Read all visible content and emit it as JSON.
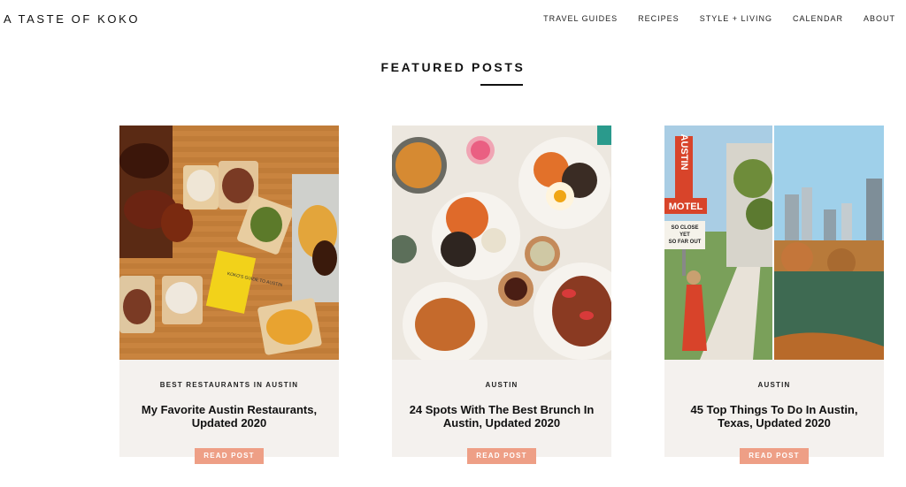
{
  "header": {
    "logo": "A TASTE OF KOKO",
    "nav": [
      "TRAVEL GUIDES",
      "RECIPES",
      "STYLE + LIVING",
      "CALENDAR",
      "ABOUT"
    ]
  },
  "section": {
    "title": "FEATURED POSTS"
  },
  "posts": [
    {
      "category": "BEST RESTAURANTS IN AUSTIN",
      "title": "My Favorite Austin Restaurants, Updated 2020",
      "button": "READ POST",
      "image_alt": "bbq-food-spread-photo"
    },
    {
      "category": "AUSTIN",
      "title": "24 Spots With The Best Brunch In Austin, Updated 2020",
      "button": "READ POST",
      "image_alt": "brunch-plates-photo"
    },
    {
      "category": "AUSTIN",
      "title": "45 Top Things To Do In Austin, Texas, Updated 2020",
      "button": "READ POST",
      "image_alt": "austin-motel-and-skyline-photo"
    }
  ],
  "image_text": {
    "book": "KOKO'S GUIDE TO AUSTIN",
    "sign_austin": "AUSTIN",
    "sign_motel": "MOTEL",
    "sign_lines": [
      "SO CLOSE",
      "YET",
      "SO FAR OUT"
    ]
  },
  "colors": {
    "accent": "#ee9f86",
    "card_bg": "#f4f1ee",
    "text": "#111111"
  }
}
